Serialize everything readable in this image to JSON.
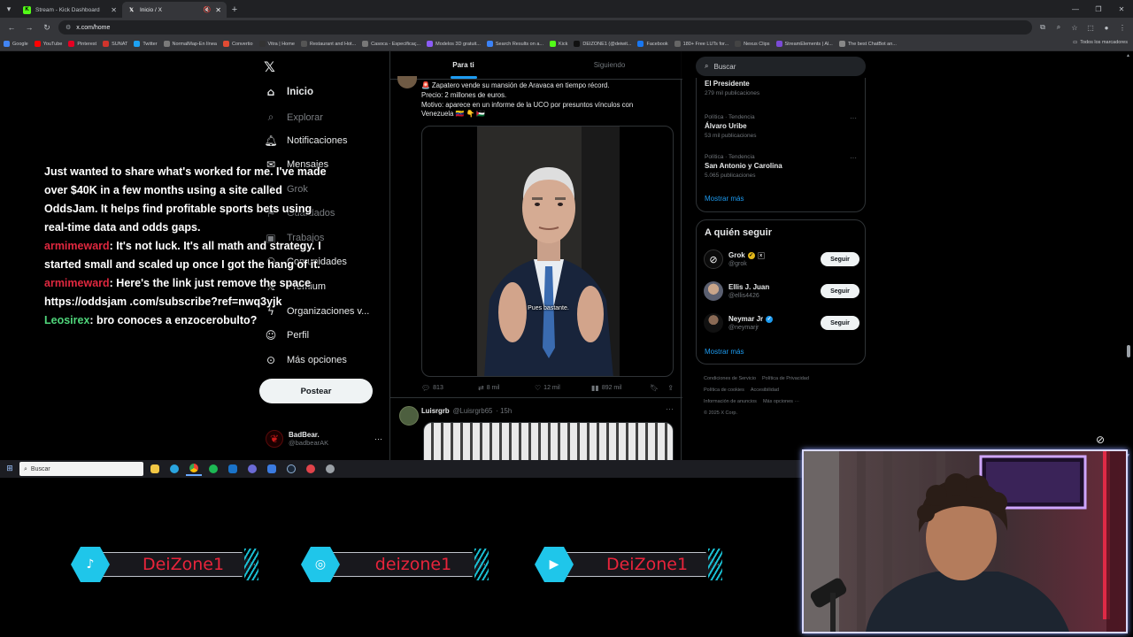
{
  "browser": {
    "tabs": [
      {
        "title": "Stream - Kick Dashboard",
        "icon": "kick-icon",
        "color": "#53fc18",
        "active": false
      },
      {
        "title": "Inicio / X",
        "icon": "x-icon",
        "color": "#ffffff",
        "active": true
      }
    ],
    "url": "x.com/home",
    "bookmarks": [
      "Google",
      "YouTube",
      "Pinterest",
      "SUNAT",
      "Twitter",
      "NormalMap-En línea",
      "Convertio",
      "Vitra | Home",
      "Restaurant and Hot...",
      "Casoca - Especificaç...",
      "Modelos 3D gratuit...",
      "Search Results on a...",
      "Kick",
      "DEIZONE1 (@deiwit...",
      "Facebook",
      "180+ Free LUTs for...",
      "Nexus Clips",
      "StreamElements | Al...",
      "The best ChatBot an..."
    ],
    "all_bookmarks": "Todos los marcadores"
  },
  "nav": {
    "items": [
      {
        "label": "Inicio",
        "icon": "home-icon"
      },
      {
        "label": "Explorar",
        "icon": "search-icon"
      },
      {
        "label": "Notificaciones",
        "icon": "bell-icon"
      },
      {
        "label": "Mensajes",
        "icon": "mail-icon"
      },
      {
        "label": "Grok",
        "icon": "grok-icon"
      },
      {
        "label": "Guardados",
        "icon": "bookmark-icon"
      },
      {
        "label": "Trabajos",
        "icon": "briefcase-icon"
      },
      {
        "label": "Comunidades",
        "icon": "communities-icon"
      },
      {
        "label": "Premium",
        "icon": "x-icon"
      },
      {
        "label": "Organizaciones v...",
        "icon": "lightning-icon"
      },
      {
        "label": "Perfil",
        "icon": "user-icon"
      },
      {
        "label": "Más opciones",
        "icon": "more-circle-icon"
      }
    ],
    "post_label": "Postear",
    "profile": {
      "name": "BadBear.",
      "handle": "@badbearAK"
    }
  },
  "feed": {
    "tabs": [
      "Para ti",
      "Siguiendo"
    ],
    "tweet1": {
      "lines": [
        "🚨 Zapatero vende su mansión de Aravaca en tiempo récord.",
        "Precio: 2 millones de euros.",
        "Motivo: aparece en un informe de la UCO por presuntos vínculos con",
        "Venezuela 🇻🇪 👇 🇵🇸"
      ],
      "video_caption": "Pues bastante.",
      "replies": "813",
      "reposts": "8 mil",
      "likes": "12 mil",
      "views": "892 mil"
    },
    "tweet2": {
      "name": "Luisrgrb",
      "handle": "@Luisrgrb65",
      "time": "· 15h"
    }
  },
  "sidebar": {
    "search_placeholder": "Buscar",
    "trends": [
      {
        "category": "",
        "title": "El Presidente",
        "posts": "279 mil publicaciones"
      },
      {
        "category": "Política · Tendencia",
        "title": "Álvaro Uribe",
        "posts": "53 mil publicaciones"
      },
      {
        "category": "Política · Tendencia",
        "title": "San Antonio y Carolina",
        "posts": "5.065 publicaciones"
      }
    ],
    "show_more": "Mostrar más",
    "who_to_follow_title": "A quién seguir",
    "follow_label": "Seguir",
    "suggestions": [
      {
        "name": "Grok",
        "handle": "@grok"
      },
      {
        "name": "Ellis J. Juan",
        "handle": "@ellis4426"
      },
      {
        "name": "Neymar Jr",
        "handle": "@neymarjr"
      }
    ],
    "footer": [
      "Condiciones de Servicio",
      "Política de Privacidad",
      "Política de cookies",
      "Accesibilidad",
      "Información de anuncios",
      "Más opciones ···",
      "© 2025 X Corp."
    ]
  },
  "chat": [
    {
      "user": "",
      "text": "Just wanted to share what's worked for me. I've made over $40K in a few months using a site called OddsJam. It helps find profitable sports bets using real-time data and odds gaps."
    },
    {
      "user": "armimeward",
      "text": ": It's not luck. It's all math and strategy. I started small and scaled up once I got the hang of it."
    },
    {
      "user": "armimeward",
      "text": ": Here's the link just remove the space https://oddsjam .com/subscribe?ref=nwq3yjk"
    },
    {
      "user": "Leosirex",
      "text": ": bro conoces a enzocerobulto?"
    }
  ],
  "taskbar": {
    "search_placeholder": "Buscar"
  },
  "socials": [
    {
      "platform": "tiktok-icon",
      "handle": "DeiZone1"
    },
    {
      "platform": "instagram-icon",
      "handle": "deizone1"
    },
    {
      "platform": "youtube-icon",
      "handle": "DeiZone1"
    }
  ],
  "colors": {
    "accent": "#1d9bf0",
    "chat_user_red": "#e0283f",
    "chat_user_green": "#4fd57a",
    "social_cyan": "#1fc6ea",
    "social_red": "#e8243b"
  }
}
